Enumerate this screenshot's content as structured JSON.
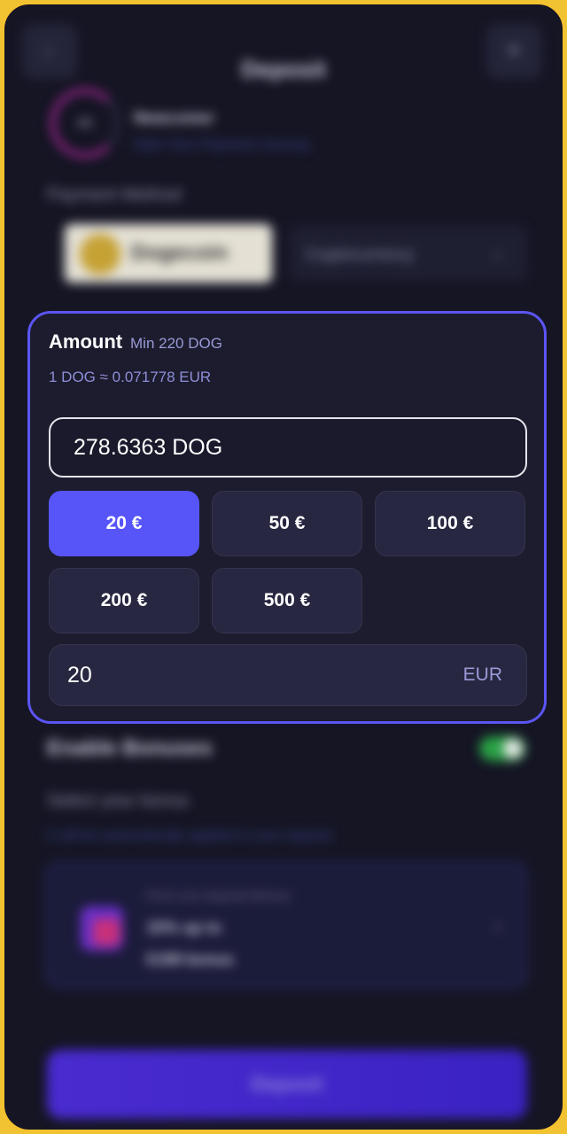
{
  "header": {
    "title": "Deposit",
    "back_icon": "back-arrow-icon",
    "close_icon": "close-icon"
  },
  "level": {
    "ring_text": "0/0",
    "title": "Newcomer",
    "subtitle": "Start Your Payment Journey"
  },
  "payment": {
    "label": "Payment Method",
    "selected_coin": "Dogecoin",
    "network_label": "Cryptocurrency",
    "coin_color": "#c6a235"
  },
  "amount": {
    "title": "Amount",
    "min_label": "Min 220 DOG",
    "rate": "1 DOG ≈ 0.071778 EUR",
    "crypto_value": "278.6363 DOG",
    "presets": [
      "20 €",
      "50 €",
      "100 €",
      "200 €",
      "500 €"
    ],
    "selected_preset": "20 €",
    "fiat_value": "20",
    "fiat_currency": "EUR",
    "accent_color": "#5755f8"
  },
  "bonus": {
    "toggle_label": "Enable Bonuses",
    "toggle_on": true,
    "select_label": "Select your bonus",
    "note": "It will be automatically applied to your deposit",
    "card_subtitle": "First Live Deposit Bonus",
    "card_line1": "15% up to",
    "card_line2": "€199 bonus"
  },
  "footer": {
    "deposit_label": "Deposit"
  }
}
